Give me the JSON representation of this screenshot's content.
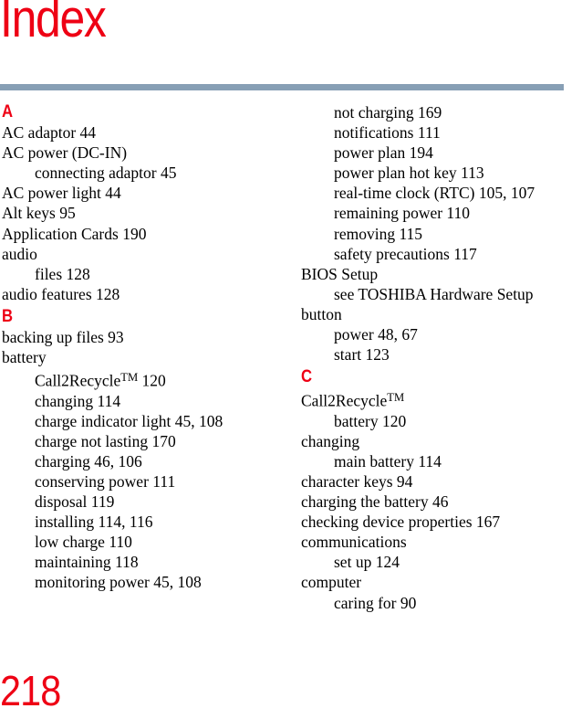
{
  "page": {
    "title": "Index",
    "folio": "218",
    "rule_color": "#879fb5",
    "accent_color": "#ee0014"
  },
  "columns": {
    "left": [
      {
        "kind": "letter",
        "text": "A"
      },
      {
        "kind": "entry",
        "level": "main",
        "text": "AC adaptor 44"
      },
      {
        "kind": "entry",
        "level": "main",
        "text": "AC power (DC-IN)"
      },
      {
        "kind": "entry",
        "level": "sub",
        "text": "connecting adaptor 45"
      },
      {
        "kind": "entry",
        "level": "main",
        "text": "AC power light 44"
      },
      {
        "kind": "entry",
        "level": "main",
        "text": "Alt keys 95"
      },
      {
        "kind": "entry",
        "level": "main",
        "text": "Application Cards 190"
      },
      {
        "kind": "entry",
        "level": "main",
        "text": "audio"
      },
      {
        "kind": "entry",
        "level": "sub",
        "text": "files 128"
      },
      {
        "kind": "entry",
        "level": "main",
        "text": "audio features 128"
      },
      {
        "kind": "letter",
        "text": "B"
      },
      {
        "kind": "entry",
        "level": "main",
        "text": "backing up files 93"
      },
      {
        "kind": "entry",
        "level": "main",
        "text": "battery"
      },
      {
        "kind": "entry",
        "level": "sub",
        "text": "Call2Recycle™ 120",
        "tm": true
      },
      {
        "kind": "entry",
        "level": "sub",
        "text": "changing 114"
      },
      {
        "kind": "entry",
        "level": "sub",
        "text": "charge indicator light 45, 108"
      },
      {
        "kind": "entry",
        "level": "sub",
        "text": "charge not lasting 170"
      },
      {
        "kind": "entry",
        "level": "sub",
        "text": "charging 46, 106"
      },
      {
        "kind": "entry",
        "level": "sub",
        "text": "conserving power 111"
      },
      {
        "kind": "entry",
        "level": "sub",
        "text": "disposal 119"
      },
      {
        "kind": "entry",
        "level": "sub",
        "text": "installing 114, 116"
      },
      {
        "kind": "entry",
        "level": "sub",
        "text": "low charge 110"
      },
      {
        "kind": "entry",
        "level": "sub",
        "text": "maintaining 118"
      },
      {
        "kind": "entry",
        "level": "sub",
        "text": "monitoring power 45, 108"
      }
    ],
    "right": [
      {
        "kind": "entry",
        "level": "sub",
        "text": "not charging 169"
      },
      {
        "kind": "entry",
        "level": "sub",
        "text": "notifications 111"
      },
      {
        "kind": "entry",
        "level": "sub",
        "text": "power plan 194"
      },
      {
        "kind": "entry",
        "level": "sub",
        "text": "power plan hot key 113"
      },
      {
        "kind": "entry",
        "level": "sub",
        "text": "real-time clock (RTC) 105, 107"
      },
      {
        "kind": "entry",
        "level": "sub",
        "text": "remaining power 110"
      },
      {
        "kind": "entry",
        "level": "sub",
        "text": "removing 115"
      },
      {
        "kind": "entry",
        "level": "sub",
        "text": "safety precautions 117"
      },
      {
        "kind": "entry",
        "level": "main",
        "text": "BIOS Setup"
      },
      {
        "kind": "entry",
        "level": "sub",
        "text": "see TOSHIBA Hardware Setup"
      },
      {
        "kind": "entry",
        "level": "main",
        "text": "button"
      },
      {
        "kind": "entry",
        "level": "sub",
        "text": "power 48, 67"
      },
      {
        "kind": "entry",
        "level": "sub",
        "text": "start 123"
      },
      {
        "kind": "letter",
        "text": "C"
      },
      {
        "kind": "entry",
        "level": "main",
        "text": "Call2Recycle™",
        "tm": true
      },
      {
        "kind": "entry",
        "level": "sub",
        "text": "battery 120"
      },
      {
        "kind": "entry",
        "level": "main",
        "text": "changing"
      },
      {
        "kind": "entry",
        "level": "sub",
        "text": "main battery 114"
      },
      {
        "kind": "entry",
        "level": "main",
        "text": "character keys 94"
      },
      {
        "kind": "entry",
        "level": "main",
        "text": "charging the battery 46"
      },
      {
        "kind": "entry",
        "level": "main",
        "text": "checking device properties 167"
      },
      {
        "kind": "entry",
        "level": "main",
        "text": "communications"
      },
      {
        "kind": "entry",
        "level": "sub",
        "text": "set up 124"
      },
      {
        "kind": "entry",
        "level": "main",
        "text": "computer"
      },
      {
        "kind": "entry",
        "level": "sub",
        "text": "caring for 90"
      }
    ]
  }
}
